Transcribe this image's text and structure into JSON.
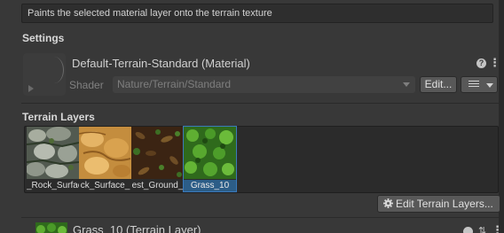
{
  "help_text": "Paints the selected material layer onto the terrain texture",
  "settings": {
    "title": "Settings",
    "material_name": "Default-Terrain-Standard (Material)",
    "help_icon_glyph": "?",
    "menu_icon_glyph": "⋮",
    "shader_label": "Shader",
    "shader_value": "Nature/Terrain/Standard",
    "edit_label": "Edit..."
  },
  "terrain_layers": {
    "title": "Terrain Layers",
    "layers": [
      {
        "label": "_Rock_Surfac",
        "texture": "rock"
      },
      {
        "label": "ck_Surface_",
        "texture": "sand"
      },
      {
        "label": "est_Ground_",
        "texture": "ground"
      },
      {
        "label": "Grass_10",
        "texture": "grass",
        "selected": true
      }
    ],
    "edit_layers_label": "Edit Terrain Layers..."
  },
  "selected_layer": {
    "name": "Grass_10 (Terrain Layer)"
  },
  "colors": {
    "background": "#383838",
    "selection": "#2c5d87",
    "help_box": "#2e2e2e"
  }
}
